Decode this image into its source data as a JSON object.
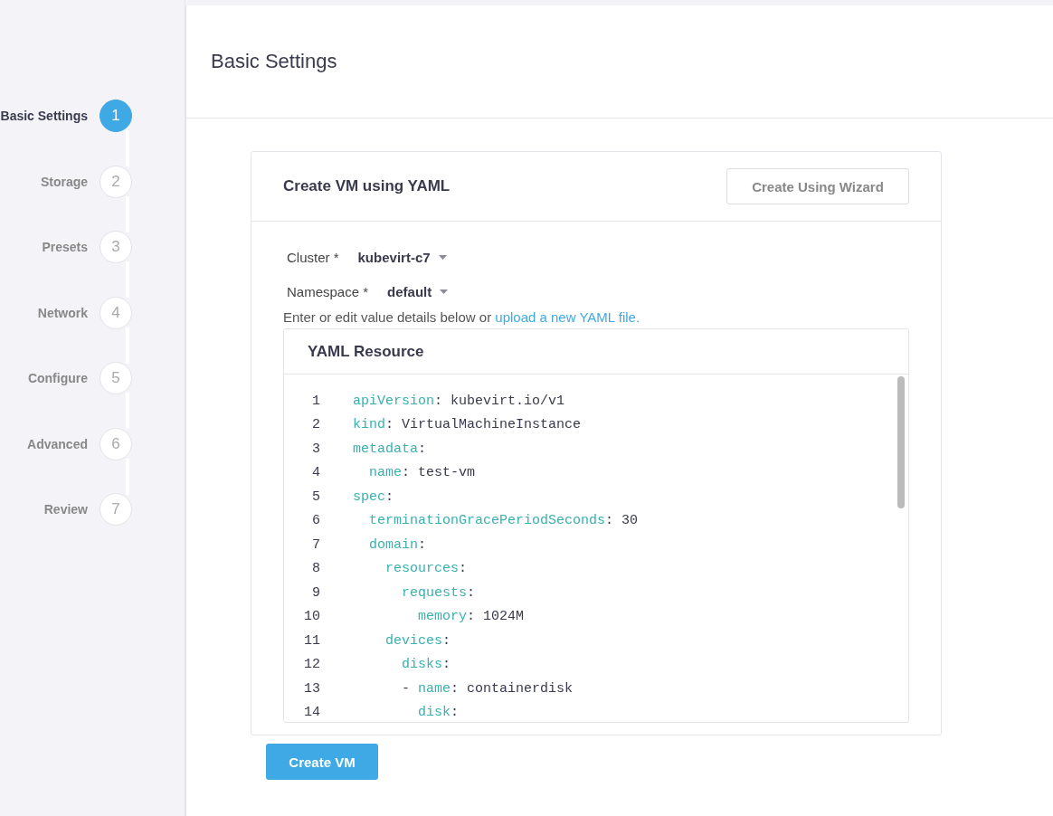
{
  "steps": [
    {
      "label": "Basic Settings",
      "number": "1",
      "selected": true
    },
    {
      "label": "Storage",
      "number": "2",
      "selected": false
    },
    {
      "label": "Presets",
      "number": "3",
      "selected": false
    },
    {
      "label": "Network",
      "number": "4",
      "selected": false
    },
    {
      "label": "Configure",
      "number": "5",
      "selected": false
    },
    {
      "label": "Advanced",
      "number": "6",
      "selected": false
    },
    {
      "label": "Review",
      "number": "7",
      "selected": false
    }
  ],
  "page_title": "Basic Settings",
  "card": {
    "title": "Create VM using YAML",
    "wizard_button": "Create Using Wizard",
    "selects": [
      {
        "label": "Cluster *",
        "value": "kubevirt-c7"
      },
      {
        "label": "Namespace *",
        "value": "default"
      }
    ],
    "hint": "Enter or edit value details below or",
    "hint_link": "upload a new YAML file.",
    "editor_title": "YAML Resource",
    "lines": [
      {
        "number": "1",
        "key": "apiVersion",
        "value": ": kubevirt.io/v1"
      },
      {
        "number": "2",
        "key": "kind",
        "value": ": VirtualMachineInstance"
      },
      {
        "number": "3",
        "key": "metadata",
        "value": ":"
      },
      {
        "number": "4",
        "key": "  name",
        "value": ": test-vm"
      },
      {
        "number": "5",
        "key": "spec",
        "value": ":"
      },
      {
        "number": "6",
        "key": "  terminationGracePeriodSeconds",
        "value": ": 30"
      },
      {
        "number": "7",
        "key": "  domain",
        "value": ":"
      },
      {
        "number": "8",
        "key": "    resources",
        "value": ":"
      },
      {
        "number": "9",
        "key": "      requests",
        "value": ":"
      },
      {
        "number": "10",
        "key": "        memory",
        "value": ": 1024M"
      },
      {
        "number": "11",
        "key": "    devices",
        "value": ":"
      },
      {
        "number": "12",
        "key": "      disks",
        "value": ":"
      },
      {
        "number": "13",
        "indent": "      - ",
        "key": "name",
        "value": ": containerdisk"
      },
      {
        "number": "14",
        "key": "        disk",
        "value": ":"
      }
    ]
  },
  "submit_button": "Create VM"
}
